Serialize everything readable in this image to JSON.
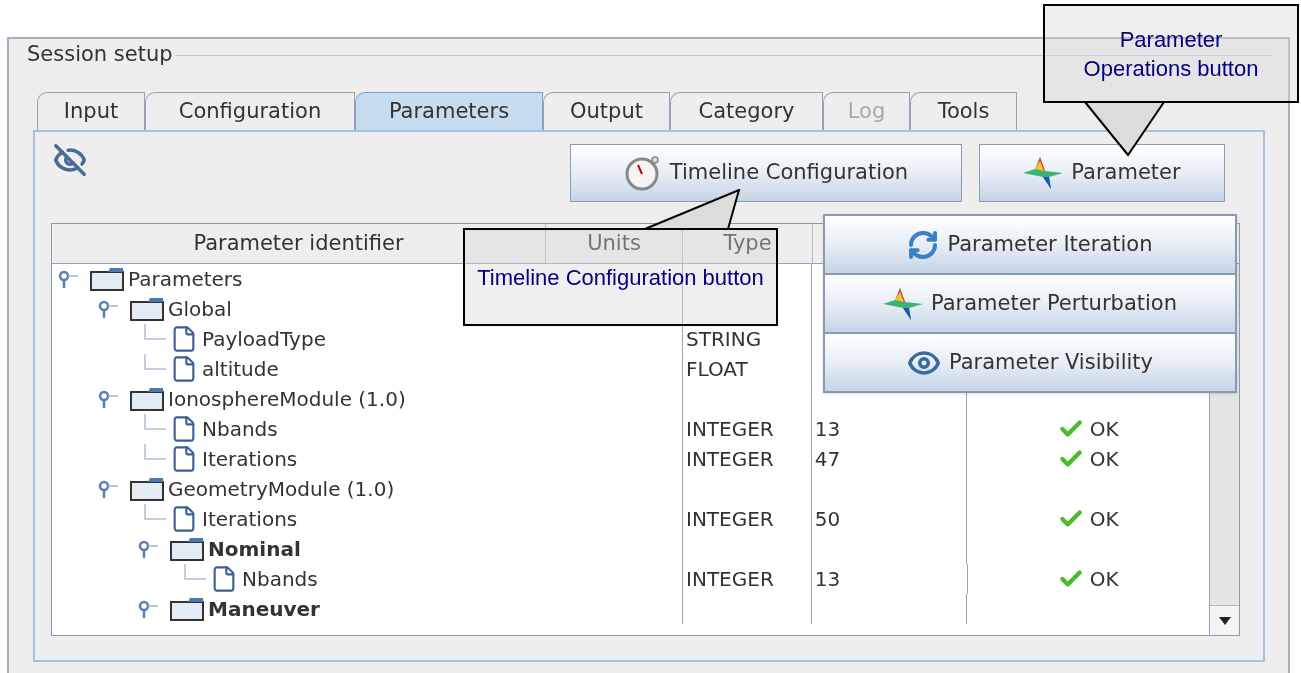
{
  "group": {
    "title": "Session setup"
  },
  "tabs": [
    {
      "label": "Input",
      "selected": false,
      "disabled": false
    },
    {
      "label": "Configuration",
      "selected": false,
      "disabled": false
    },
    {
      "label": "Parameters",
      "selected": true,
      "disabled": false
    },
    {
      "label": "Output",
      "selected": false,
      "disabled": false
    },
    {
      "label": "Category",
      "selected": false,
      "disabled": false
    },
    {
      "label": "Log",
      "selected": false,
      "disabled": true
    },
    {
      "label": "Tools",
      "selected": false,
      "disabled": false
    }
  ],
  "buttons": [
    {
      "label": "Timeline Configuration"
    },
    {
      "label": "Parameter"
    }
  ],
  "table": {
    "columns": [
      "Parameter identifier",
      "Units",
      "Type"
    ],
    "tree": [
      {
        "label": "Parameters",
        "kind": "folder",
        "bold": false,
        "expanded": true,
        "children": [
          {
            "label": "Global",
            "kind": "folder",
            "bold": false,
            "expanded": true,
            "children": [
              {
                "label": "PayloadType",
                "kind": "file",
                "bold": false,
                "type": "STRING"
              },
              {
                "label": "altitude",
                "kind": "file",
                "bold": false,
                "type": "FLOAT"
              }
            ]
          },
          {
            "label": "IonosphereModule (1.0)",
            "kind": "folder",
            "bold": false,
            "expanded": true,
            "children": [
              {
                "label": "Nbands",
                "kind": "file",
                "bold": false,
                "type": "INTEGER",
                "value": "13",
                "status": "OK"
              },
              {
                "label": "Iterations",
                "kind": "file",
                "bold": false,
                "type": "INTEGER",
                "value": "47",
                "status": "OK"
              }
            ]
          },
          {
            "label": "GeometryModule (1.0)",
            "kind": "folder",
            "bold": false,
            "expanded": true,
            "children": [
              {
                "label": "Iterations",
                "kind": "file",
                "bold": false,
                "type": "INTEGER",
                "value": "50",
                "status": "OK"
              },
              {
                "label": "Nominal",
                "kind": "folder",
                "bold": true,
                "expanded": true,
                "children": [
                  {
                    "label": "Nbands",
                    "kind": "file",
                    "bold": false,
                    "type": "INTEGER",
                    "value": "13",
                    "status": "OK"
                  }
                ]
              },
              {
                "label": "Maneuver",
                "kind": "folder",
                "bold": true,
                "expanded": true
              }
            ]
          }
        ]
      }
    ]
  },
  "menu": {
    "items": [
      {
        "label": "Parameter Iteration"
      },
      {
        "label": "Parameter Perturbation"
      },
      {
        "label": "Parameter Visibility"
      }
    ]
  },
  "callouts": [
    {
      "text": "Timeline Configuration button"
    },
    {
      "text": "Parameter Operations button"
    }
  ]
}
